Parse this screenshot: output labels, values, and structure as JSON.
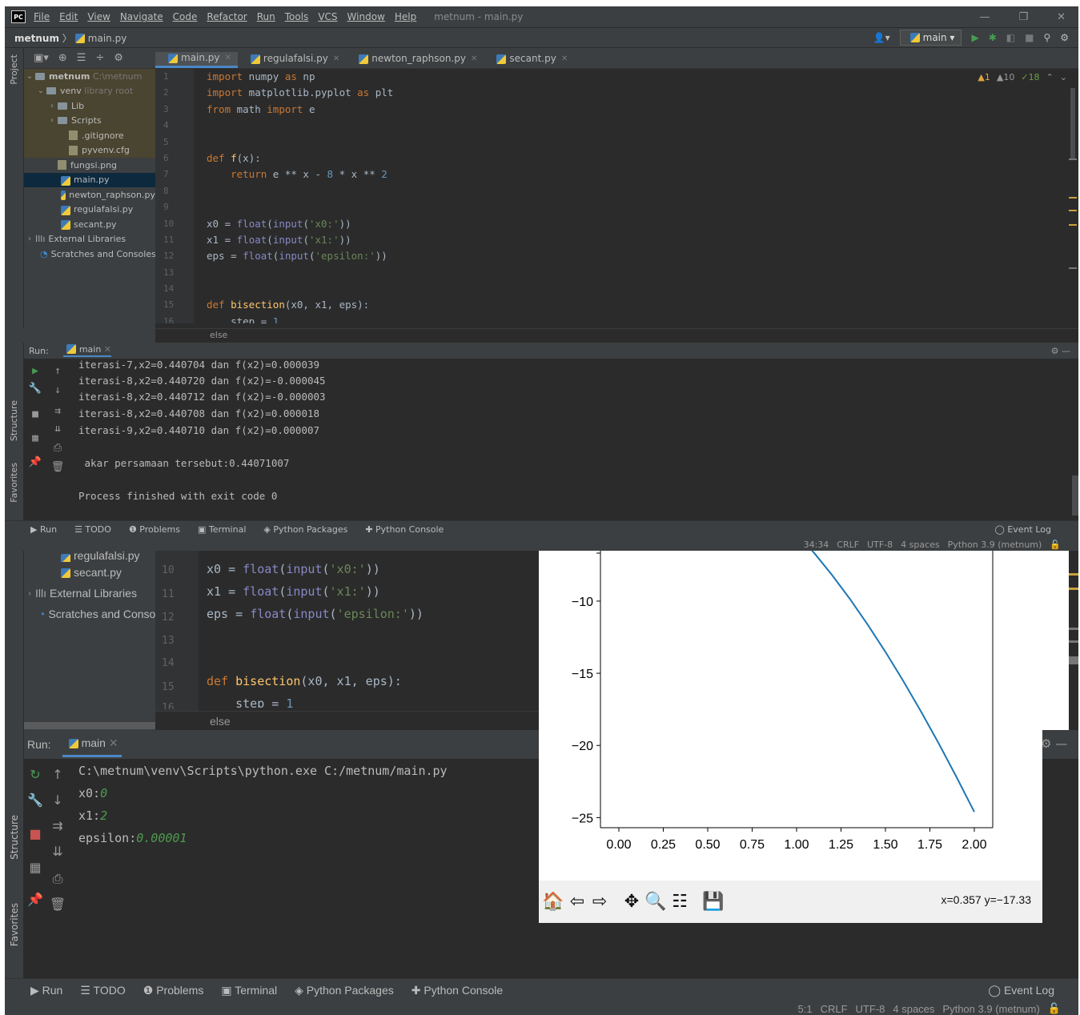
{
  "titlebar": {
    "menu": [
      "File",
      "Edit",
      "View",
      "Navigate",
      "Code",
      "Refactor",
      "Run",
      "Tools",
      "VCS",
      "Window",
      "Help"
    ],
    "window_title": "metnum - main.py",
    "logo": "PC",
    "controls": [
      "—",
      "❐",
      "✕"
    ]
  },
  "navbar": {
    "project": "metnum",
    "file": "main.py",
    "run_config": "main"
  },
  "side_tabs": {
    "project": "Project",
    "structure": "Structure",
    "favorites": "Favorites"
  },
  "project_tree": {
    "root": "metnum",
    "root_path": "C:\\metnum",
    "venv": "venv",
    "venv_note": "library root",
    "items": [
      "Lib",
      "Scripts",
      ".gitignore",
      "pyvenv.cfg",
      "fungsi.png",
      "main.py",
      "newton_raphson.py",
      "regulafalsi.py",
      "secant.py",
      "External Libraries",
      "Scratches and Consoles"
    ]
  },
  "editor_tabs": [
    "main.py",
    "regulafalsi.py",
    "newton_raphson.py",
    "secant.py"
  ],
  "inspections": {
    "errors": "1",
    "warnings": "10",
    "weak": "18"
  },
  "code": {
    "line_numbers": [
      "1",
      "2",
      "3",
      "4",
      "5",
      "6",
      "7",
      "8",
      "9",
      "10",
      "11",
      "12",
      "13",
      "14",
      "15",
      "16"
    ],
    "lines": [
      "import numpy as np",
      "import matplotlib.pyplot as plt",
      "from math import e",
      "",
      "",
      "def f(x):",
      "    return e ** x - 8 * x ** 2",
      "",
      "",
      "x0 = float(input('x0:'))",
      "x1 = float(input('x1:'))",
      "eps = float(input('epsilon:'))",
      "",
      "",
      "def bisection(x0, x1, eps):",
      "    step = 1"
    ],
    "breadcrumb": "else"
  },
  "run_panel": {
    "label": "Run:",
    "tab": "main",
    "output": [
      "iterasi-7,x2=0.440704 dan f(x2)=0.000039",
      "iterasi-8,x2=0.440720 dan f(x2)=-0.000045",
      "iterasi-8,x2=0.440712 dan f(x2)=-0.000003",
      "iterasi-8,x2=0.440708 dan f(x2)=0.000018",
      "iterasi-9,x2=0.440710 dan f(x2)=0.000007",
      "",
      " akar persamaan tersebut:0.44071007",
      "",
      "Process finished with exit code 0"
    ]
  },
  "bottom_tabs": [
    "Run",
    "TODO",
    "Problems",
    "Terminal",
    "Python Packages",
    "Python Console"
  ],
  "event_log": "Event Log",
  "status1": {
    "position": "34:34",
    "line_sep": "CRLF",
    "encoding": "UTF-8",
    "indent": "4 spaces",
    "interpreter": "Python 3.9 (metnum)"
  },
  "status2": {
    "position": "5:1",
    "line_sep": "CRLF",
    "encoding": "UTF-8",
    "indent": "4 spaces",
    "interpreter": "Python 3.9 (metnum)"
  },
  "lower": {
    "tree_items": [
      "regulafalsi.py",
      "secant.py",
      "External Libraries",
      "Scratches and Consoles"
    ],
    "console": {
      "command": "C:\\metnum\\venv\\Scripts\\python.exe C:/metnum/main.py",
      "prompts": [
        {
          "label": "x0:",
          "value": "0"
        },
        {
          "label": "x1:",
          "value": "2"
        },
        {
          "label": "epsilon:",
          "value": "0.00001"
        }
      ]
    }
  },
  "plot_status": "x=0.357 y=−17.33",
  "chart_data": {
    "type": "line",
    "title": "",
    "xlabel": "",
    "ylabel": "",
    "x_ticks": [
      "0.00",
      "0.25",
      "0.50",
      "0.75",
      "1.00",
      "1.25",
      "1.50",
      "1.75",
      "2.00"
    ],
    "y_ticks": [
      "−10",
      "−15",
      "−20",
      "−25"
    ],
    "xlim": [
      0,
      2
    ],
    "ylim_visible": [
      -25.7,
      -5.4
    ],
    "series": [
      {
        "color": "#1f77b4",
        "x": [
          0.96,
          1.0,
          1.1,
          1.2,
          1.3,
          1.4,
          1.5,
          1.6,
          1.7,
          1.8,
          1.9,
          2.0
        ],
        "y": [
          -4.76,
          -5.28,
          -6.68,
          -8.2,
          -9.85,
          -11.63,
          -13.52,
          -15.53,
          -17.65,
          -19.87,
          -22.2,
          -24.61
        ]
      }
    ]
  }
}
